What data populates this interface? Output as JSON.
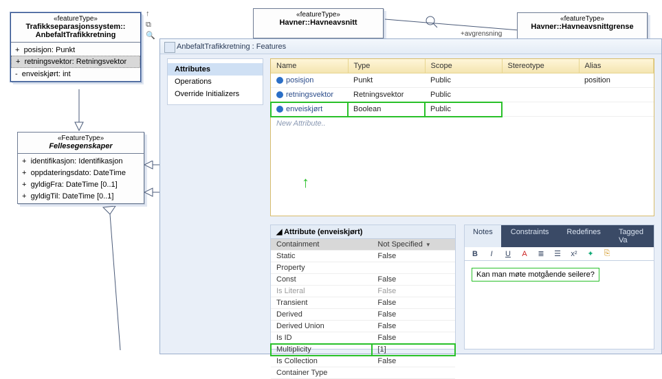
{
  "uml": {
    "box1": {
      "stereotype": "«featureType»",
      "title": "Trafikkseparasjonssystem::\nAnbefaltTrafikkretning",
      "attrs": [
        {
          "vis": "+",
          "text": "posisjon: Punkt"
        },
        {
          "vis": "+",
          "text": "retningsvektor: Retningsvektor"
        },
        {
          "vis": "-",
          "text": "enveiskjørt: int"
        }
      ]
    },
    "box2": {
      "stereotype": "«FeatureType»",
      "title": "Fellesegenskaper",
      "attrs": [
        {
          "vis": "+",
          "text": "identifikasjon: Identifikasjon"
        },
        {
          "vis": "+",
          "text": "oppdateringsdato: DateTime"
        },
        {
          "vis": "+",
          "text": "gyldigFra: DateTime [0..1]"
        },
        {
          "vis": "+",
          "text": "gyldigTil: DateTime [0..1]"
        }
      ]
    },
    "box3": {
      "stereotype": "«featureType»",
      "title": "Havner::Havneavsnitt"
    },
    "box4": {
      "stereotype": "«featureType»",
      "title": "Havner::Havneavsnittgrense"
    },
    "assoc": "+avgrensning"
  },
  "dlg": {
    "title": "AnbefaltTrafikkretning : Features",
    "nav": [
      "Attributes",
      "Operations",
      "Override Initializers"
    ],
    "gridHeaders": [
      "Name",
      "Type",
      "Scope",
      "Stereotype",
      "Alias"
    ],
    "rows": [
      {
        "name": "posisjon",
        "type": "Punkt",
        "scope": "Public",
        "stereo": "",
        "alias": "position"
      },
      {
        "name": "retningsvektor",
        "type": "Retningsvektor",
        "scope": "Public",
        "stereo": "",
        "alias": ""
      },
      {
        "name": "enveiskjørt",
        "type": "Boolean",
        "scope": "Public",
        "stereo": "",
        "alias": ""
      }
    ],
    "newAttr": "New Attribute..",
    "propsTitle": "Attribute (enveiskjørt)",
    "props": [
      {
        "k": "Containment",
        "v": "Not Specified",
        "dd": true,
        "hl": true
      },
      {
        "k": "Static",
        "v": "False"
      },
      {
        "k": "Property",
        "v": ""
      },
      {
        "k": "Const",
        "v": "False"
      },
      {
        "k": "Is Literal",
        "v": "False",
        "gray": true
      },
      {
        "k": "Transient",
        "v": "False"
      },
      {
        "k": "Derived",
        "v": "False"
      },
      {
        "k": "Derived Union",
        "v": "False"
      },
      {
        "k": "Is ID",
        "v": "False"
      },
      {
        "k": "Multiplicity",
        "v": "[1]",
        "boxhl": true
      },
      {
        "k": "Is Collection",
        "v": "False"
      },
      {
        "k": "Container Type",
        "v": ""
      }
    ],
    "tabs": [
      "Notes",
      "Constraints",
      "Redefines",
      "Tagged Va"
    ],
    "noteText": "Kan man møte motgående seilere?"
  }
}
